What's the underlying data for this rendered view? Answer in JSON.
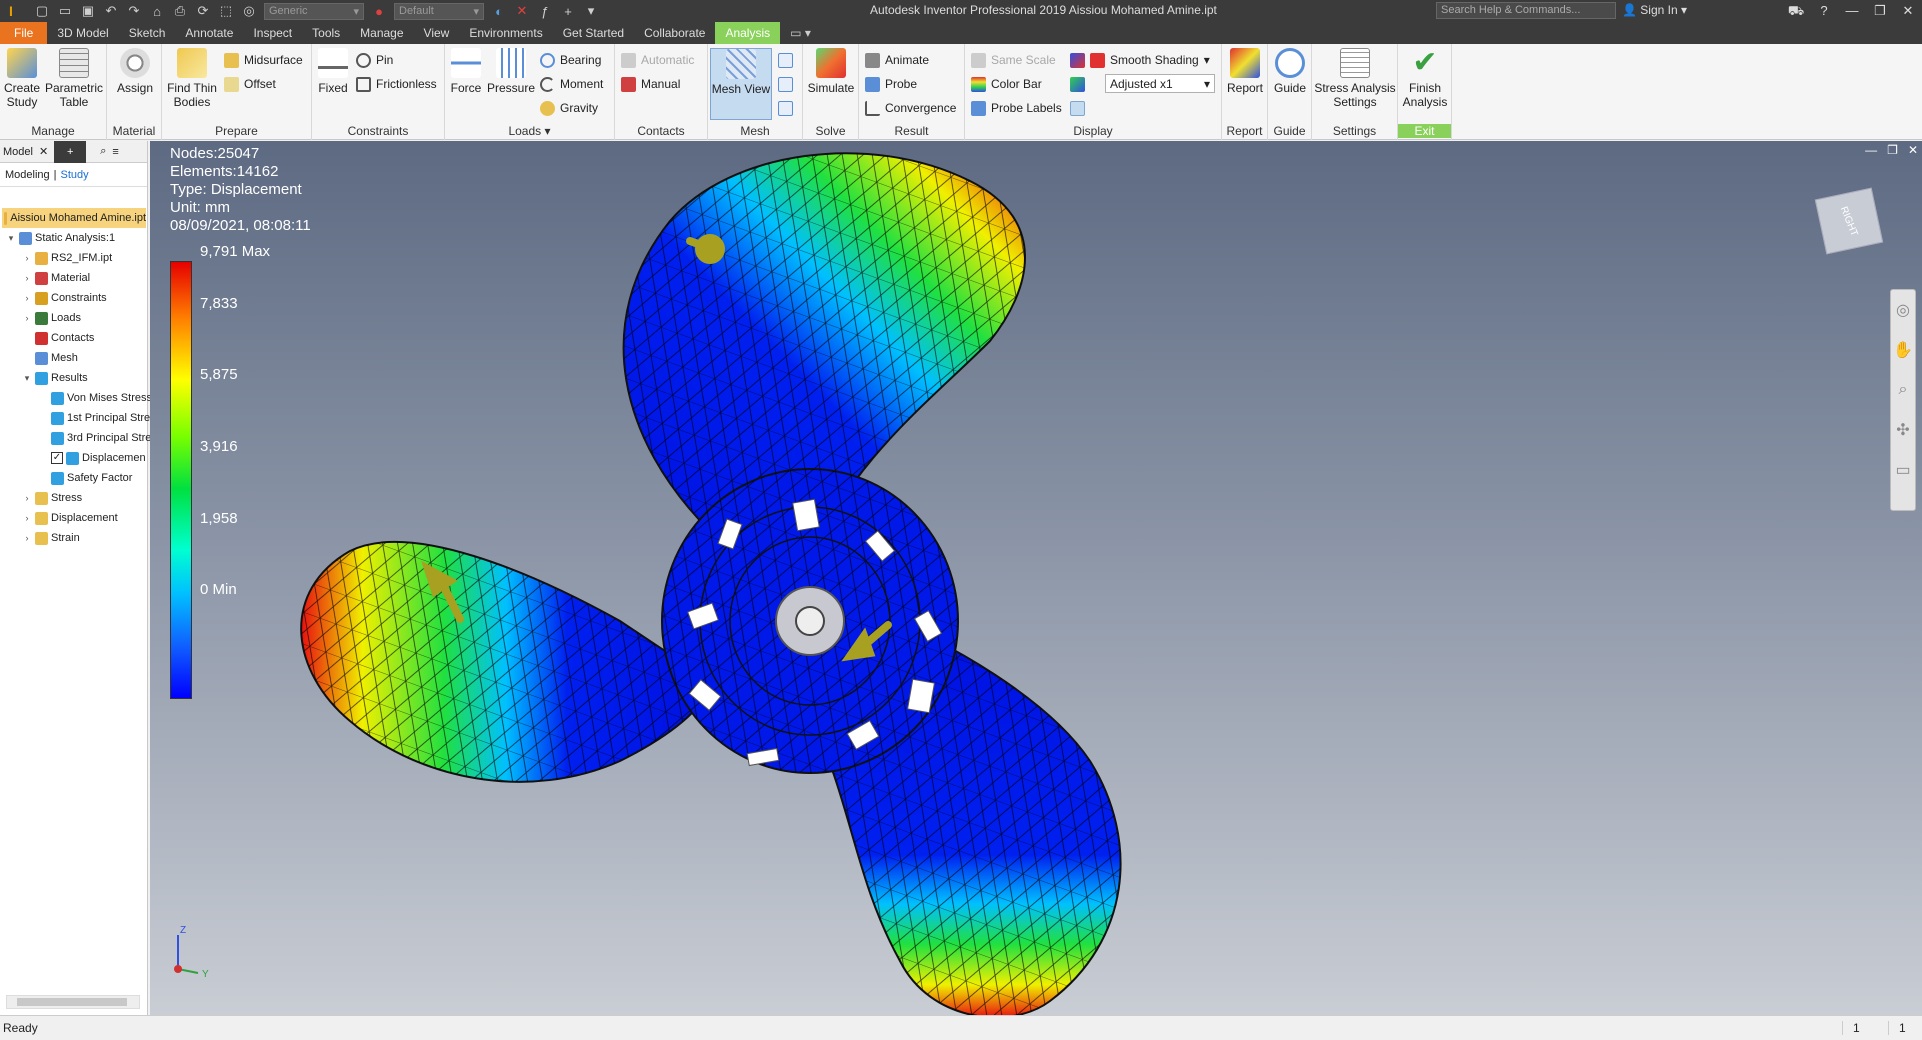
{
  "titlebar": {
    "app_logo": "I",
    "title": "Autodesk Inventor Professional 2019   Aissiou Mohamed Amine.ipt",
    "material_select": "Generic",
    "appearance_select": "Default",
    "search_placeholder": "Search Help & Commands...",
    "sign_in": "Sign In"
  },
  "menu": {
    "tabs": [
      "File",
      "3D Model",
      "Sketch",
      "Annotate",
      "Inspect",
      "Tools",
      "Manage",
      "View",
      "Environments",
      "Get Started",
      "Collaborate",
      "Analysis"
    ],
    "active": "Analysis"
  },
  "ribbon": {
    "manage": {
      "label": "Manage",
      "create_study": "Create Study",
      "parametric_table": "Parametric Table"
    },
    "material": {
      "label": "Material",
      "assign": "Assign"
    },
    "prepare": {
      "label": "Prepare",
      "find_thin_bodies": "Find Thin Bodies",
      "midsurface": "Midsurface",
      "offset": "Offset"
    },
    "constraints": {
      "label": "Constraints",
      "fixed": "Fixed",
      "pin": "Pin",
      "frictionless": "Frictionless"
    },
    "loads": {
      "label": "Loads",
      "force": "Force",
      "pressure": "Pressure",
      "bearing": "Bearing",
      "moment": "Moment",
      "gravity": "Gravity"
    },
    "contacts": {
      "label": "Contacts",
      "automatic": "Automatic",
      "manual": "Manual"
    },
    "mesh": {
      "label": "Mesh",
      "mesh_view": "Mesh View"
    },
    "solve": {
      "label": "Solve",
      "simulate": "Simulate"
    },
    "result": {
      "label": "Result",
      "animate": "Animate",
      "probe": "Probe",
      "convergence": "Convergence"
    },
    "display": {
      "label": "Display",
      "same_scale": "Same Scale",
      "color_bar": "Color Bar",
      "probe_labels": "Probe Labels",
      "shading": "Smooth Shading",
      "adjust": "Adjusted x1"
    },
    "report": {
      "label": "Report",
      "report": "Report"
    },
    "guide": {
      "label": "Guide",
      "guide": "Guide"
    },
    "settings": {
      "label": "Settings",
      "stress_settings": "Stress Analysis Settings"
    },
    "exit": {
      "label": "Exit",
      "finish": "Finish Analysis"
    }
  },
  "browser": {
    "tab_model": "Model",
    "tab_modeling": "Modeling",
    "tab_study": "Study",
    "nodes": [
      {
        "label": "Aissiou Mohamed Amine.ipt",
        "level": 0,
        "toggle": "",
        "color": "#e8b040"
      },
      {
        "label": "Static Analysis:1",
        "level": 0,
        "toggle": "v",
        "color": "#5a8fd8"
      },
      {
        "label": "RS2_IFM.ipt",
        "level": 1,
        "toggle": ">",
        "color": "#e8b040"
      },
      {
        "label": "Material",
        "level": 1,
        "toggle": ">",
        "color": "#d04040"
      },
      {
        "label": "Constraints",
        "level": 1,
        "toggle": ">",
        "color": "#d8a020"
      },
      {
        "label": "Loads",
        "level": 1,
        "toggle": ">",
        "color": "#3a7a3a"
      },
      {
        "label": "Contacts",
        "level": 1,
        "toggle": "",
        "color": "#d03030"
      },
      {
        "label": "Mesh",
        "level": 1,
        "toggle": "",
        "color": "#5a8fd8"
      },
      {
        "label": "Results",
        "level": 1,
        "toggle": "v",
        "color": "#30a0e0"
      },
      {
        "label": "Von Mises Stress",
        "level": 2,
        "toggle": "",
        "color": "#30a0e0"
      },
      {
        "label": "1st Principal Stre",
        "level": 2,
        "toggle": "",
        "color": "#30a0e0"
      },
      {
        "label": "3rd Principal Stre",
        "level": 2,
        "toggle": "",
        "color": "#30a0e0"
      },
      {
        "label": "Displacemen",
        "level": 2,
        "toggle": "",
        "color": "#30a0e0",
        "checked": true
      },
      {
        "label": "Safety Factor",
        "level": 2,
        "toggle": "",
        "color": "#30a0e0"
      },
      {
        "label": "Stress",
        "level": 1,
        "toggle": ">",
        "color": "#e8c050"
      },
      {
        "label": "Displacement",
        "level": 1,
        "toggle": ">",
        "color": "#e8c050"
      },
      {
        "label": "Strain",
        "level": 1,
        "toggle": ">",
        "color": "#e8c050"
      }
    ]
  },
  "viewport": {
    "nodes": "Nodes:25047",
    "elements": "Elements:14162",
    "type": "Type: Displacement",
    "unit": "Unit: mm",
    "timestamp": "08/09/2021, 08:08:11",
    "legend_max": "9,791 Max",
    "legend_values": [
      "7,833",
      "5,875",
      "3,916",
      "1,958",
      "0 Min"
    ],
    "viewcube_label": "RIGHT",
    "axis_z": "Z",
    "axis_y": "Y"
  },
  "status": {
    "text": "Ready",
    "cell1": "1",
    "cell2": "1"
  }
}
